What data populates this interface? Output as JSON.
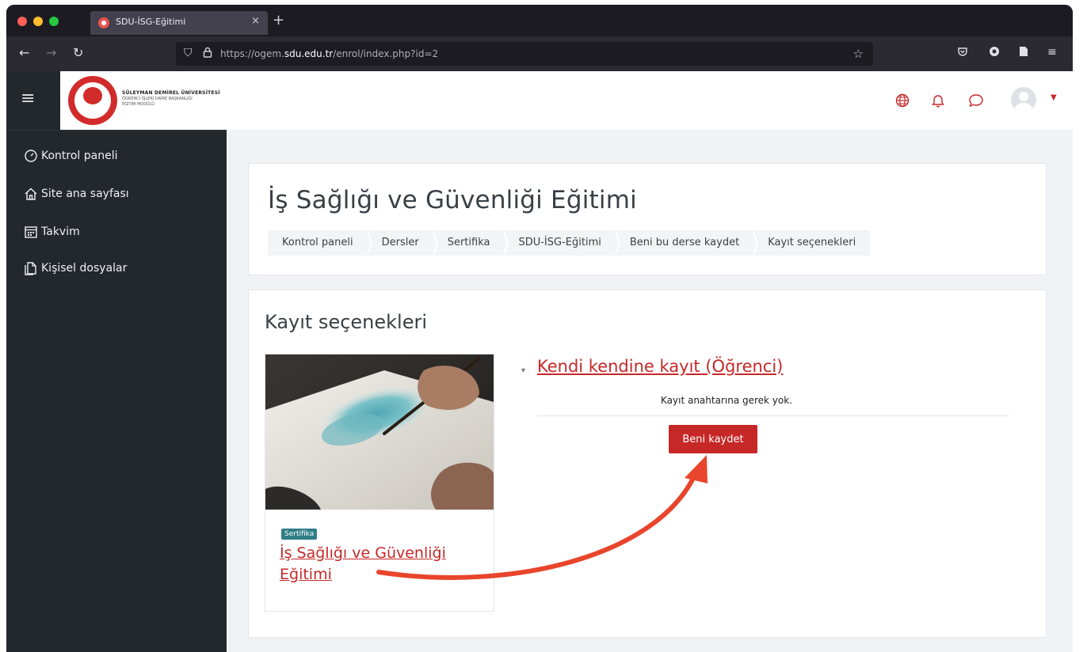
{
  "browser": {
    "tab_title": "SDU-İSG-Eğitimi",
    "tab_close": "×",
    "new_tab": "+",
    "url_prefix": "https://ogem.",
    "url_domain": "sdu.edu.tr",
    "url_path": "/enrol/index.php?id=2"
  },
  "header": {
    "logo_line1": "SÜLEYMAN DEMİREL ÜNİVERSİTESİ",
    "logo_line2": "ÖĞRENCİ İŞLERİ DAİRE BAŞKANLIĞI",
    "logo_line3": "EĞİTİM MODÜLÜ",
    "accent_color": "#c62828"
  },
  "sidebar": {
    "items": [
      {
        "label": "Kontrol paneli",
        "icon": "dashboard-icon"
      },
      {
        "label": "Site ana sayfası",
        "icon": "home-icon"
      },
      {
        "label": "Takvim",
        "icon": "calendar-icon"
      },
      {
        "label": "Kişisel dosyalar",
        "icon": "files-icon"
      }
    ]
  },
  "page": {
    "title": "İş Sağlığı ve Güvenliği Eğitimi",
    "breadcrumb": [
      "Kontrol paneli",
      "Dersler",
      "Sertifika",
      "SDU-İSG-Eğitimi",
      "Beni bu derse kaydet",
      "Kayıt seçenekleri"
    ]
  },
  "enrol": {
    "section_title": "Kayıt seçenekleri",
    "course_category": "Sertifika",
    "course_name": "İş Sağlığı ve Güvenliği Eğitimi",
    "method_title": "Kendi kendine kayıt (Öğrenci)",
    "note": "Kayıt anahtarına gerek yok.",
    "button_label": "Beni kaydet",
    "toggle_icon": "▾"
  }
}
